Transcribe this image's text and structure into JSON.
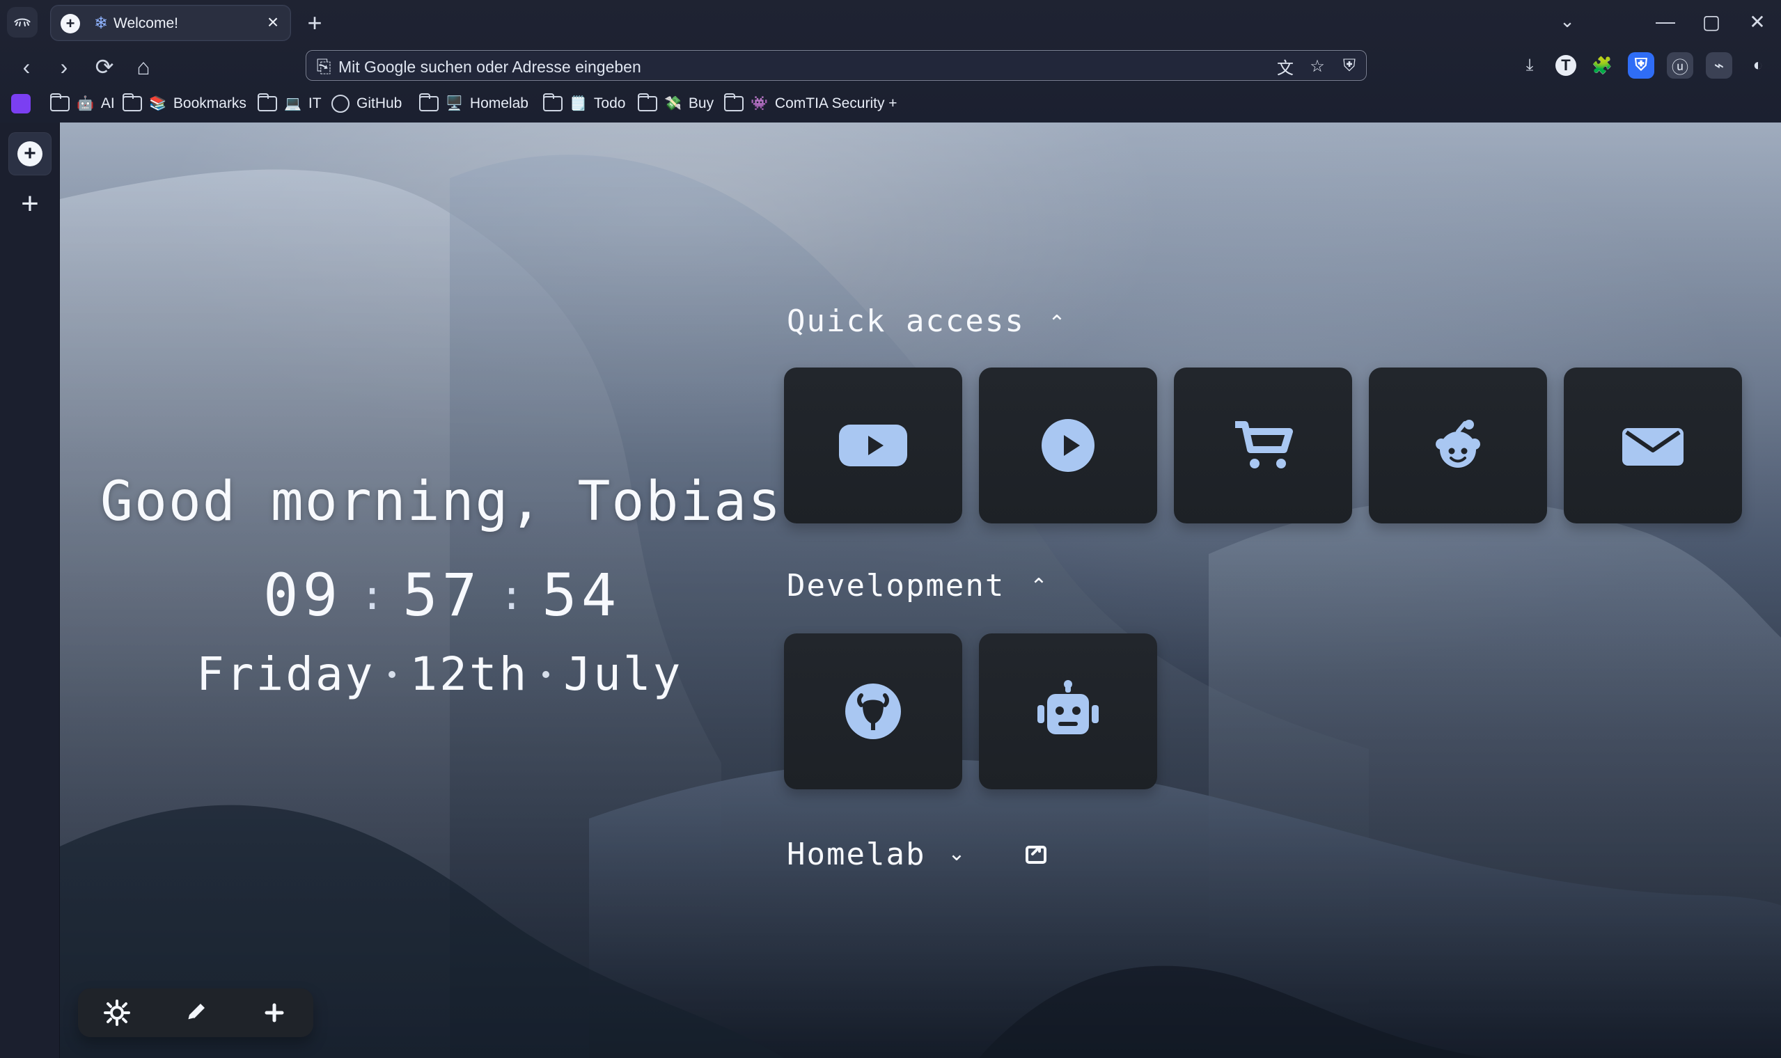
{
  "browser": {
    "active_tab": {
      "title": "Welcome!"
    },
    "address_bar": {
      "placeholder": "Mit Google suchen oder Adresse eingeben"
    },
    "bookmarks": [
      {
        "label": "AI",
        "emoji": "🤖"
      },
      {
        "label": "Bookmarks",
        "emoji": "📚"
      },
      {
        "label": "IT",
        "emoji": "💻"
      },
      {
        "label": "GitHub",
        "emoji": ""
      },
      {
        "label": "Homelab",
        "emoji": "🖥️"
      },
      {
        "label": "Todo",
        "emoji": "🗒️"
      },
      {
        "label": "Buy",
        "emoji": "💸"
      },
      {
        "label": "ComTIA Security +",
        "emoji": "👾"
      }
    ],
    "extensions": {
      "t_label": "T"
    }
  },
  "startpage": {
    "greeting": "Good morning, Tobias",
    "time": {
      "hh": "09",
      "mm": "57",
      "ss": "54"
    },
    "date": {
      "weekday": "Friday",
      "day": "12th",
      "month": "July"
    },
    "sections": [
      {
        "key": "quick",
        "title": "Quick access"
      },
      {
        "key": "dev",
        "title": "Development"
      },
      {
        "key": "homelab",
        "title": "Homelab"
      }
    ]
  }
}
